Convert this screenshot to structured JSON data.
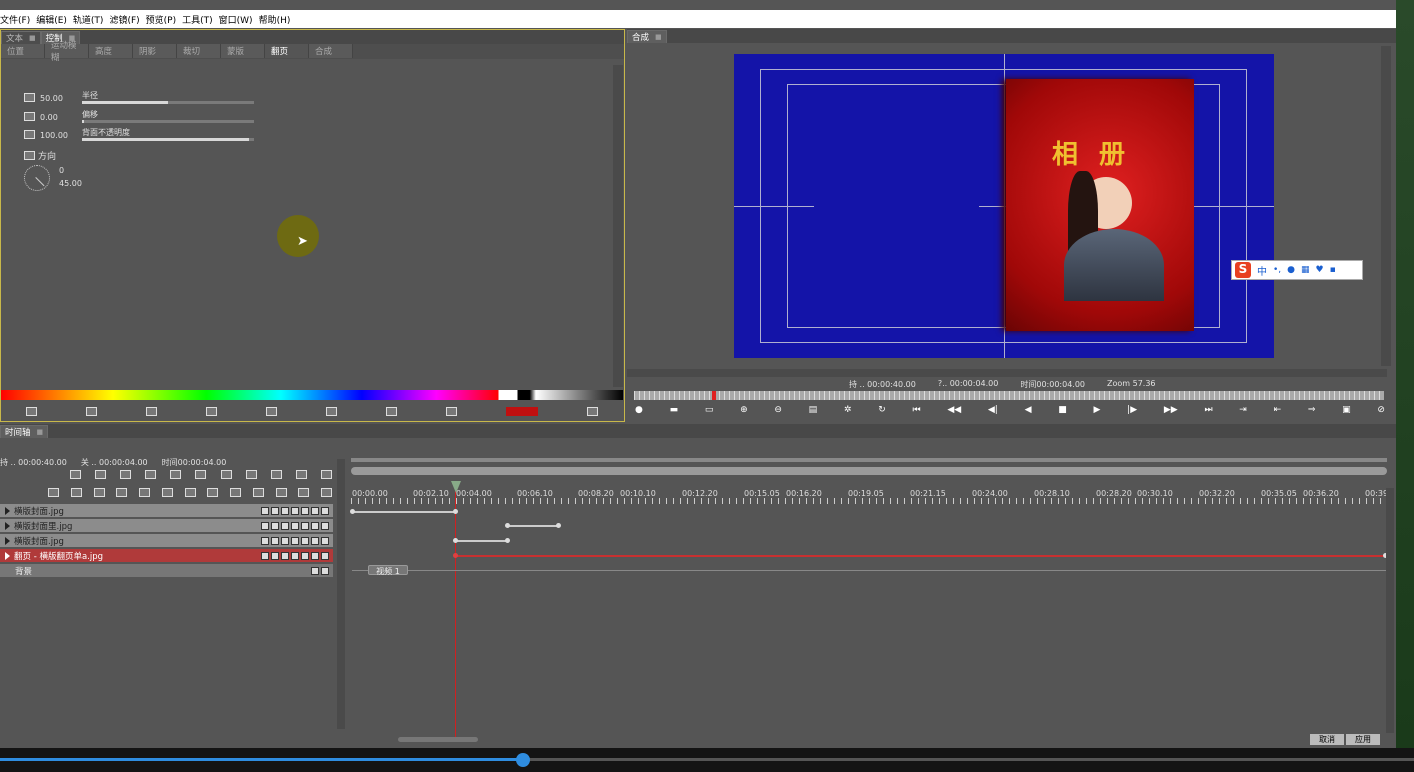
{
  "menu": [
    "文件(F)",
    "编辑(E)",
    "轨道(T)",
    "滤镜(F)",
    "预览(P)",
    "工具(T)",
    "窗口(W)",
    "帮助(H)"
  ],
  "left_panel": {
    "tabs": [
      "文本",
      "控制"
    ],
    "subtabs": [
      "位置",
      "运动模糊",
      "高度",
      "阴影",
      "裁切",
      "蒙版",
      "翻页",
      "合成"
    ],
    "active_subtab": "翻页",
    "params": [
      {
        "value": "50.00",
        "label": "半径",
        "level": 0.5
      },
      {
        "value": "0.00",
        "label": "偏移",
        "level": 0.0
      },
      {
        "value": "100.00",
        "label": "背面不透明度",
        "level": 1.0
      }
    ],
    "direction_label": "方向",
    "direction_values": [
      "0",
      "45.00"
    ]
  },
  "preview": {
    "tab": "合成",
    "title_text": "相 册",
    "status_hold": "持 .. 00:00:40.00",
    "status_q": "?.. 00:00:04.00",
    "status_time": "时间00:00:04.00",
    "status_zoom": "Zoom  57.36",
    "ime": {
      "logo": "S",
      "lang": "中",
      "punct": "•,"
    }
  },
  "timeline": {
    "tab": "时间轴",
    "hold": "持 .. 00:00:40.00",
    "close": "关 .. 00:00:04.00",
    "time": "时间00:00:04.00",
    "ticks": [
      "00:00.00",
      "00:02.10",
      "00:04.00",
      "00:06.10",
      "00:08.20",
      "00:10.10",
      "00:12.20",
      "00:15.05",
      "00:16.20",
      "00:19.05",
      "00:21.15",
      "00:24.00",
      "00:28.10",
      "00:28.20",
      "00:30.10",
      "00:32.20",
      "00:35.05",
      "00:36.20",
      "00:39."
    ],
    "tracks": [
      {
        "name": "横版封面.jpg"
      },
      {
        "name": "横版封面里.jpg"
      },
      {
        "name": "横版封面.jpg"
      },
      {
        "name": "翻页 - 横版翻页单a.jpg",
        "selected": true
      }
    ],
    "background_label": "背景",
    "video_label": "视频 1",
    "buttons": {
      "cancel": "取消",
      "apply": "应用"
    }
  },
  "colors": {
    "preview_bg": "#1414a8",
    "selected_track": "#b03a3a",
    "accent": "#2f8de0"
  }
}
